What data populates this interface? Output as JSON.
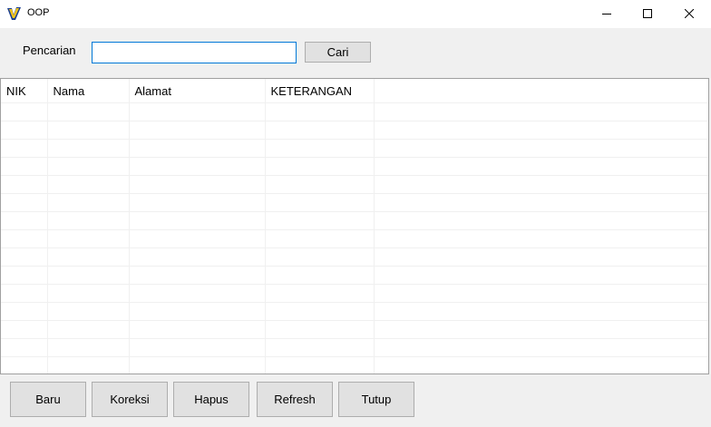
{
  "window": {
    "title": "OOP",
    "icon": "app-logo-icon",
    "controls": {
      "minimize_icon": "minimize-icon",
      "maximize_icon": "maximize-icon",
      "close_icon": "close-icon"
    }
  },
  "search": {
    "label": "Pencarian",
    "value": "",
    "button_label": "Cari"
  },
  "grid": {
    "columns": [
      "NIK",
      "Nama",
      "Alamat",
      "KETERANGAN"
    ],
    "rows": []
  },
  "actions": {
    "baru": "Baru",
    "koreksi": "Koreksi",
    "hapus": "Hapus",
    "refresh": "Refresh",
    "tutup": "Tutup"
  },
  "colors": {
    "accent": "#0078d7",
    "button_bg": "#e1e1e1",
    "window_bg": "#f0f0f0"
  }
}
